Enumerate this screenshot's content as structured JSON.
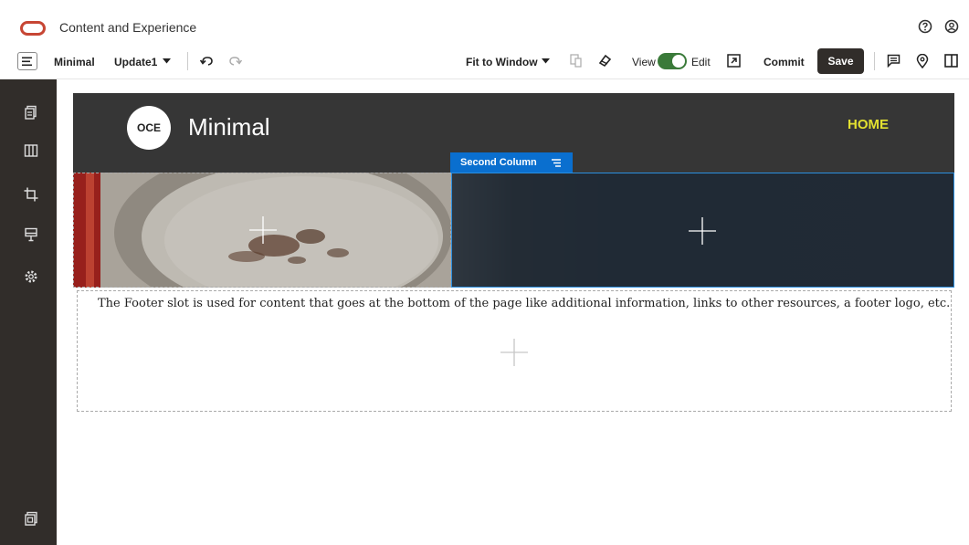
{
  "header": {
    "app_title": "Content and Experience"
  },
  "toolbar": {
    "site_name": "Minimal",
    "update_name": "Update1",
    "zoom": "Fit to Window",
    "view_label": "View",
    "edit_label": "Edit",
    "commit_label": "Commit",
    "save_label": "Save",
    "edit_mode_on": true
  },
  "site": {
    "logo_text": "OCE",
    "name": "Minimal",
    "nav_home": "HOME"
  },
  "slots": {
    "second_column_label": "Second Column",
    "footer_text": "The Footer slot is used for content that goes at the bottom of the page like additional information, links to other resources, a footer logo, etc."
  },
  "colors": {
    "brand_red": "#c74634",
    "rail": "#312d2a",
    "toggle_on": "#3a7a39",
    "selection_blue": "#0a6fcf",
    "home_link": "#e2e030"
  },
  "icons": {
    "rail": [
      "pages-icon",
      "components-icon",
      "crop-icon",
      "theme-icon",
      "settings-icon",
      "site-icon"
    ]
  }
}
